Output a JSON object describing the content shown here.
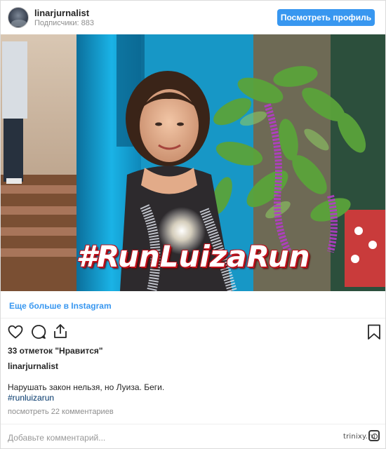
{
  "header": {
    "username": "linarjurnalist",
    "followers": "Подписчики: 883",
    "view_profile_label": "Посмотреть профиль"
  },
  "post": {
    "image_overlay_text": "#RunLuizaRun",
    "more_link": "Еще больше в Instagram",
    "likes": "33 отметок \"Нравится\"",
    "caption_user": "linarjurnalist",
    "caption_text": "Нарушать закон нельзя, но Луиза. Беги.",
    "caption_hashtag": "#runluizarun",
    "comments_link": "посмотреть 22 комментариев",
    "comment_placeholder": "Добавьте комментарий..."
  },
  "watermark": "trinixy.ru",
  "icons": {
    "like": "heart-icon",
    "comment": "comment-icon",
    "share": "share-icon",
    "save": "bookmark-icon",
    "watermark_logo": "instagram-glyph-icon"
  },
  "colors": {
    "accent": "#3897f0",
    "hashtag_link": "#003569",
    "muted": "#8e8e8e",
    "text": "#262626",
    "overlay_text_outline": "#c0101a"
  }
}
